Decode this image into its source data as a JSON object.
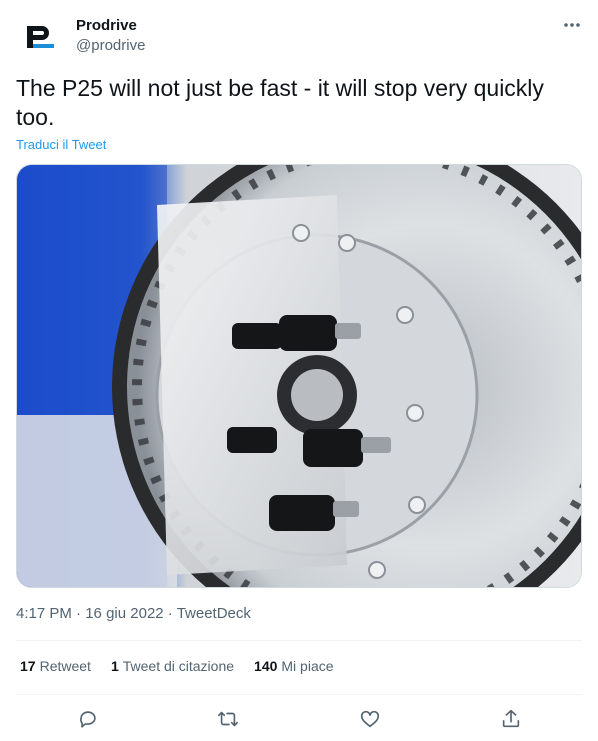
{
  "author": {
    "name": "Prodrive",
    "handle": "@prodrive",
    "avatar_icon": "prodrive-logo",
    "brand_color": "#1e8fd6"
  },
  "tweet": {
    "text": "The P25 will not just be fast - it will stop very quickly too.",
    "translate_label": "Traduci il Tweet",
    "media_alt": "brake-disc-caliper-photo"
  },
  "meta": {
    "time": "4:17 PM",
    "date": "16 giu 2022",
    "separator": "·",
    "source": "TweetDeck"
  },
  "stats": {
    "retweets_count": "17",
    "retweets_label": "Retweet",
    "quotes_count": "1",
    "quotes_label": "Tweet di citazione",
    "likes_count": "140",
    "likes_label": "Mi piace"
  },
  "actions": [
    "reply-icon",
    "retweet-icon",
    "like-icon",
    "share-icon"
  ],
  "colors": {
    "text": "#0f1419",
    "secondary": "#536471",
    "link": "#1d9bf0",
    "divider": "#eff3f4"
  }
}
